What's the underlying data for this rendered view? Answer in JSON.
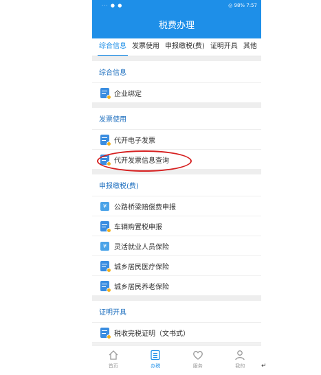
{
  "status_bar": {
    "left": "··· ● ●",
    "right": "◎ 98% 7:57"
  },
  "title": "税费办理",
  "tabs": [
    {
      "label": "综合信息"
    },
    {
      "label": "发票使用"
    },
    {
      "label": "申报缴税(费)"
    },
    {
      "label": "证明开具"
    },
    {
      "label": "其他"
    }
  ],
  "sections": [
    {
      "title": "综合信息",
      "items": [
        {
          "label": "企业绑定"
        }
      ]
    },
    {
      "title": "发票使用",
      "items": [
        {
          "label": "代开电子发票"
        },
        {
          "label": "代开发票信息查询"
        }
      ]
    },
    {
      "title": "申报缴税(费)",
      "items": [
        {
          "label": "公路桥梁赔偿费申报"
        },
        {
          "label": "车辆购置税申报"
        },
        {
          "label": "灵活就业人员保险"
        },
        {
          "label": "城乡居民医疗保险"
        },
        {
          "label": "城乡居民养老保险"
        }
      ]
    },
    {
      "title": "证明开具",
      "items": [
        {
          "label": "税收完税证明（文书式）"
        }
      ]
    }
  ],
  "bottom_nav": [
    {
      "label": "首页",
      "icon": "home-icon"
    },
    {
      "label": "办税",
      "icon": "list-icon"
    },
    {
      "label": "服务",
      "icon": "heart-icon"
    },
    {
      "label": "我的",
      "icon": "user-icon"
    }
  ],
  "accent_color": "#1e8fe8",
  "highlight_color": "#d62020",
  "footnote_mark": "↵"
}
